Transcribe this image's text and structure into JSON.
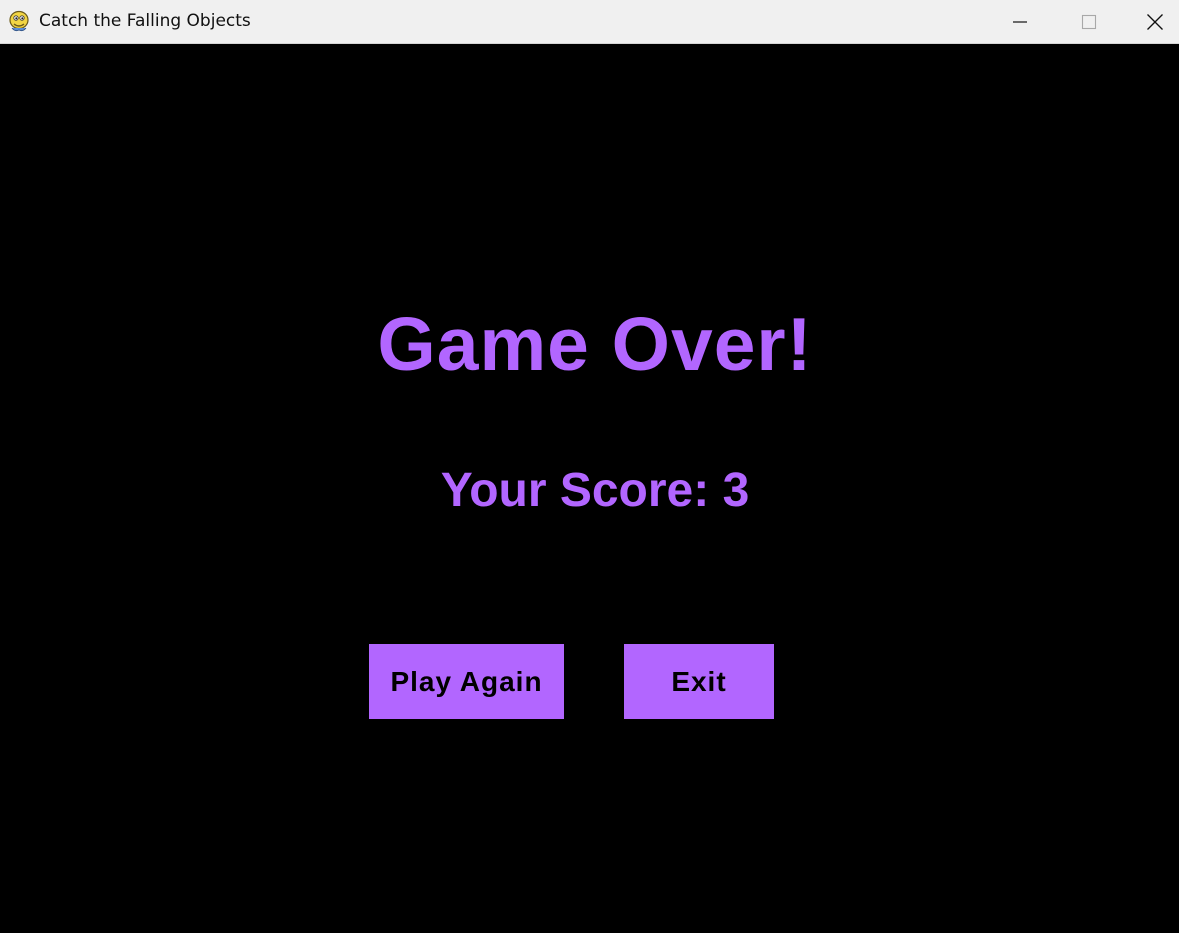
{
  "window": {
    "title": "Catch the Falling Objects",
    "app_icon": "pygame-snake-icon",
    "controls": {
      "minimize_icon": "minimize-icon",
      "maximize_icon": "maximize-icon",
      "close_icon": "close-icon"
    }
  },
  "game_over": {
    "heading": "Game Over!",
    "score_label": "Your Score: 3",
    "score": 3,
    "buttons": {
      "play_again": "Play Again",
      "exit": "Exit"
    }
  },
  "colors": {
    "background": "#000000",
    "accent": "#b266ff",
    "button_text": "#000000",
    "titlebar": "#f0f0f0"
  }
}
